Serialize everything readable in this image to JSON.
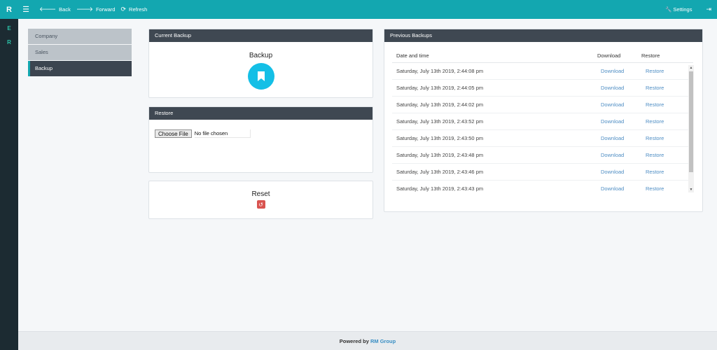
{
  "topbar": {
    "brand": "R",
    "back_label": "Back",
    "forward_label": "Forward",
    "refresh_label": "Refresh",
    "settings_label": "Settings"
  },
  "rail": [
    "E",
    "R"
  ],
  "leftnav": [
    {
      "label": "Company",
      "active": false
    },
    {
      "label": "Sales",
      "active": false
    },
    {
      "label": "Backup",
      "active": true
    }
  ],
  "current_backup": {
    "header": "Current Backup",
    "title": "Backup"
  },
  "restore": {
    "header": "Restore",
    "file_button": "Choose File",
    "file_status": "No file chosen"
  },
  "reset": {
    "title": "Reset"
  },
  "previous_backups": {
    "header": "Previous Backups",
    "columns": {
      "date": "Date and time",
      "download": "Download",
      "restore": "Restore"
    },
    "rows": [
      {
        "date": "Saturday, July 13th 2019, 2:44:08 pm",
        "download": "Download",
        "restore": "Restore"
      },
      {
        "date": "Saturday, July 13th 2019, 2:44:05 pm",
        "download": "Download",
        "restore": "Restore"
      },
      {
        "date": "Saturday, July 13th 2019, 2:44:02 pm",
        "download": "Download",
        "restore": "Restore"
      },
      {
        "date": "Saturday, July 13th 2019, 2:43:52 pm",
        "download": "Download",
        "restore": "Restore"
      },
      {
        "date": "Saturday, July 13th 2019, 2:43:50 pm",
        "download": "Download",
        "restore": "Restore"
      },
      {
        "date": "Saturday, July 13th 2019, 2:43:48 pm",
        "download": "Download",
        "restore": "Restore"
      },
      {
        "date": "Saturday, July 13th 2019, 2:43:46 pm",
        "download": "Download",
        "restore": "Restore"
      },
      {
        "date": "Saturday, July 13th 2019, 2:43:43 pm",
        "download": "Download",
        "restore": "Restore"
      }
    ]
  },
  "footer": {
    "prefix": "Powered by",
    "brand": "RM Group"
  },
  "colors": {
    "topbar": "#13a7b0",
    "rail": "#1c2b32",
    "panel_header": "#3f4852",
    "backup_accent": "#14bfe6",
    "reset_accent": "#d9534f",
    "link": "#4f8ec4"
  },
  "icons": {
    "menu": "hamburger-icon",
    "back": "arrow-left-icon",
    "forward": "arrow-right-icon",
    "refresh": "refresh-icon",
    "settings": "wrench-icon",
    "logout": "sign-out-icon",
    "backup": "bookmark-icon",
    "reset": "undo-icon"
  }
}
